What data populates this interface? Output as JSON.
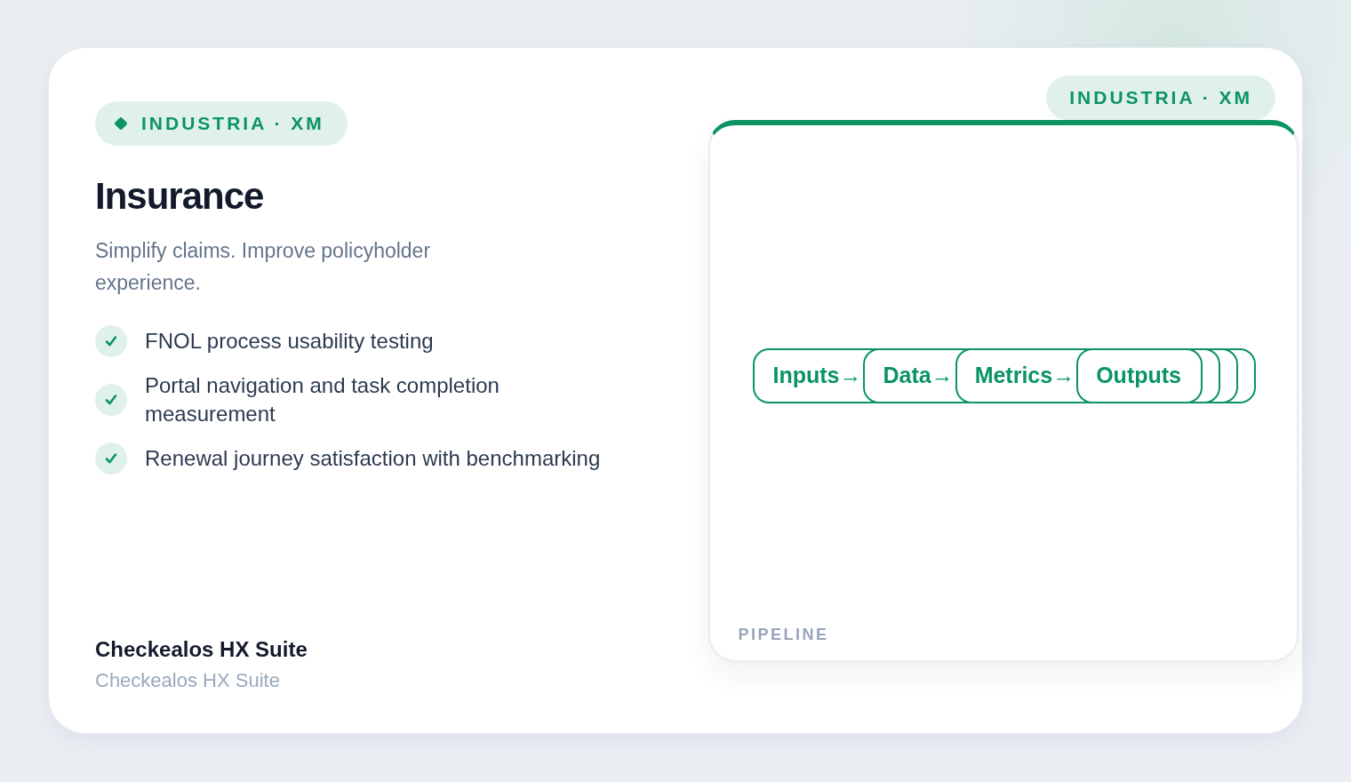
{
  "card": {
    "badge": {
      "label": "INDUSTRIA · XM"
    },
    "title": "Insurance",
    "subtitle": "Simplify claims. Improve policyholder experience.",
    "features": [
      {
        "text": "FNOL process usability testing",
        "checked": true
      },
      {
        "text": "Portal navigation and task completion measurement",
        "checked": true
      },
      {
        "text": "Renewal journey satisfaction with benchmarking",
        "checked": true
      }
    ],
    "product": {
      "name": "Checkealos HX Suite",
      "subname": "Checkealos HX Suite"
    }
  },
  "preview": {
    "badge": "INDUSTRIA · XM",
    "steps": [
      {
        "label": "Inputs→"
      },
      {
        "label": "Data→"
      },
      {
        "label": "Metrics→"
      },
      {
        "label": "Outputs"
      }
    ],
    "caption": "PIPELINE"
  }
}
